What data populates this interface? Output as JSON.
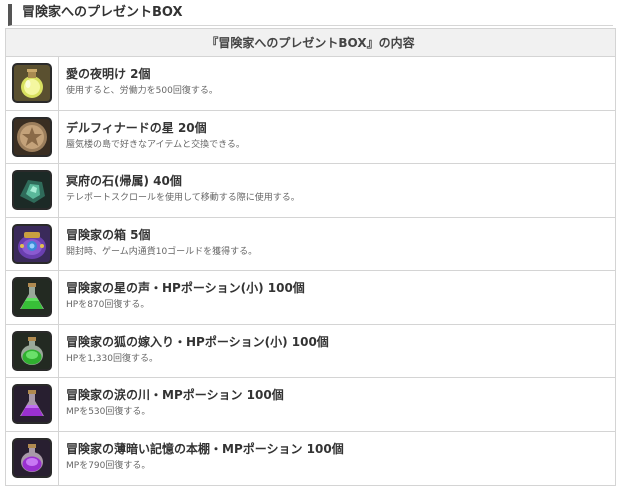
{
  "page_heading": "冒険家へのプレゼントBOX",
  "table": {
    "header": "『冒険家へのプレゼントBOX』の内容",
    "items": [
      {
        "icon": "yellow-potion-icon",
        "name": "愛の夜明け 2個",
        "desc": "使用すると、労働力を500回復する。"
      },
      {
        "icon": "star-coin-icon",
        "name": "デルフィナードの星 20個",
        "desc": "蜃気楼の島で好きなアイテムと交換できる。"
      },
      {
        "icon": "teleport-stone-icon",
        "name": "冥府の石(帰属) 40個",
        "desc": "テレポートスクロールを使用して移動する際に使用する。"
      },
      {
        "icon": "treasure-pouch-icon",
        "name": "冒険家の箱 5個",
        "desc": "開封時、ゲーム内通貨10ゴールドを獲得する。"
      },
      {
        "icon": "green-flask-icon",
        "name": "冒険家の星の声・HPポーション(小) 100個",
        "desc": "HPを870回復する。"
      },
      {
        "icon": "green-flask-icon",
        "name": "冒険家の狐の嫁入り・HPポーション(小) 100個",
        "desc": "HPを1,330回復する。"
      },
      {
        "icon": "purple-flask-icon",
        "name": "冒険家の涙の川・MPポーション 100個",
        "desc": "MPを530回復する。"
      },
      {
        "icon": "purple-flask-icon",
        "name": "冒険家の薄暗い記憶の本棚・MPポーション 100個",
        "desc": "MPを790回復する。"
      }
    ]
  }
}
